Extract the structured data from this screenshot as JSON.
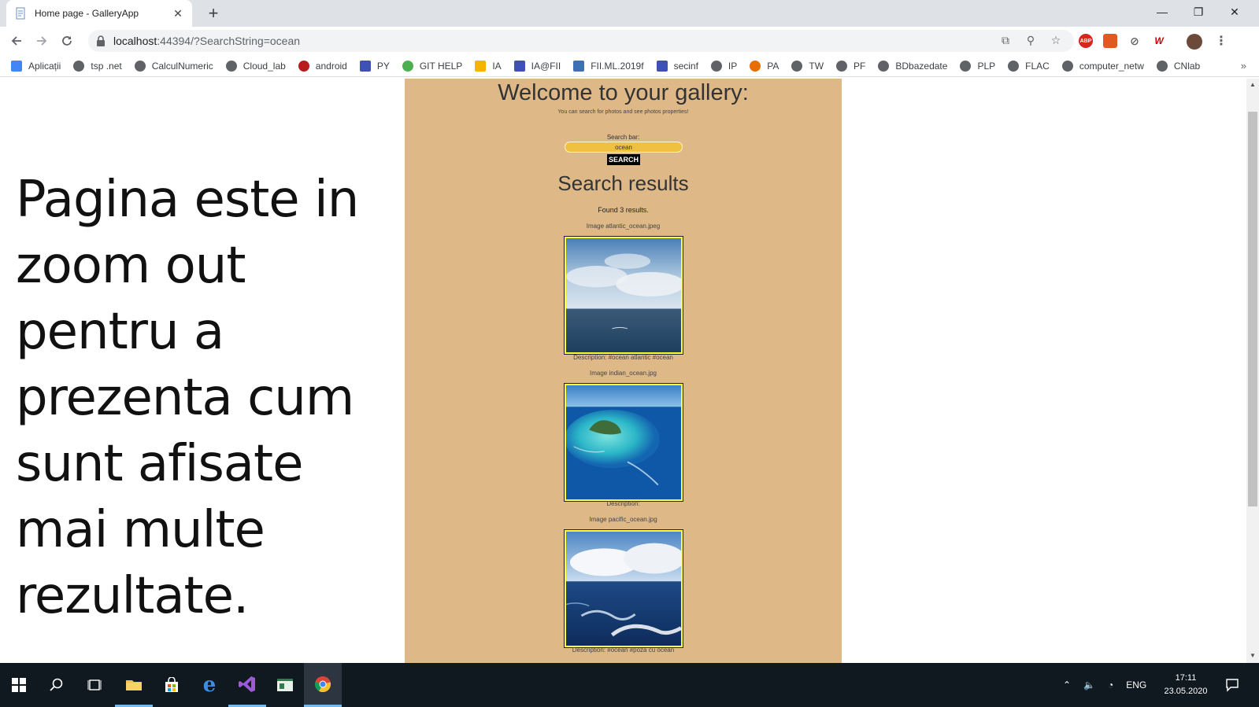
{
  "browser": {
    "tab_title": "Home page - GalleryApp",
    "url_host": "localhost",
    "url_rest": ":44394/?SearchString=ocean",
    "bookmarks": [
      {
        "label": "Aplicații",
        "icon": "apps-grid-icon"
      },
      {
        "label": "tsp .net",
        "icon": "globe-icon"
      },
      {
        "label": "CalculNumeric",
        "icon": "globe-icon"
      },
      {
        "label": "Cloud_lab",
        "icon": "globe-icon"
      },
      {
        "label": "android",
        "icon": "strawberry-icon"
      },
      {
        "label": "PY",
        "icon": "forms-icon"
      },
      {
        "label": "GIT HELP",
        "icon": "refresh-green-icon"
      },
      {
        "label": "IA",
        "icon": "slides-icon"
      },
      {
        "label": "IA@FII",
        "icon": "forms-icon"
      },
      {
        "label": "FII.ML.2019f",
        "icon": "p-icon"
      },
      {
        "label": "secinf",
        "icon": "forms-icon"
      },
      {
        "label": "IP",
        "icon": "globe-icon"
      },
      {
        "label": "PA",
        "icon": "java-icon"
      },
      {
        "label": "TW",
        "icon": "globe-icon"
      },
      {
        "label": "PF",
        "icon": "globe-icon"
      },
      {
        "label": "BDbazedate",
        "icon": "globe-icon"
      },
      {
        "label": "PLP",
        "icon": "globe-icon"
      },
      {
        "label": "FLAC",
        "icon": "globe-icon"
      },
      {
        "label": "computer_netw",
        "icon": "globe-icon"
      },
      {
        "label": "CNlab",
        "icon": "globe-icon"
      }
    ],
    "more_bookmarks": "»",
    "extensions": {
      "abp": "ABP",
      "wf": "W"
    }
  },
  "note": {
    "text": "Pagina este in zoom out pentru a prezenta cum sunt afisate mai multe rezultate."
  },
  "gallery": {
    "title": "Welcome to your gallery:",
    "subtitle": "You can search for photos and see photos properties!",
    "search_label": "Search bar:",
    "search_value": "ocean",
    "search_button": "SEARCH",
    "results_title": "Search results",
    "found_text": "Found 3 results.",
    "results": [
      {
        "name": "Image atlantic_ocean.jpeg",
        "description": "Description: #ocean atlantic #ocean"
      },
      {
        "name": "Image indian_ocean.jpg",
        "description": "Description:"
      },
      {
        "name": "Image pacific_ocean.jpg",
        "description": "Description: #ocean #poza cu ocean"
      }
    ]
  },
  "taskbar": {
    "language": "ENG",
    "time": "17:11",
    "date": "23.05.2020"
  }
}
